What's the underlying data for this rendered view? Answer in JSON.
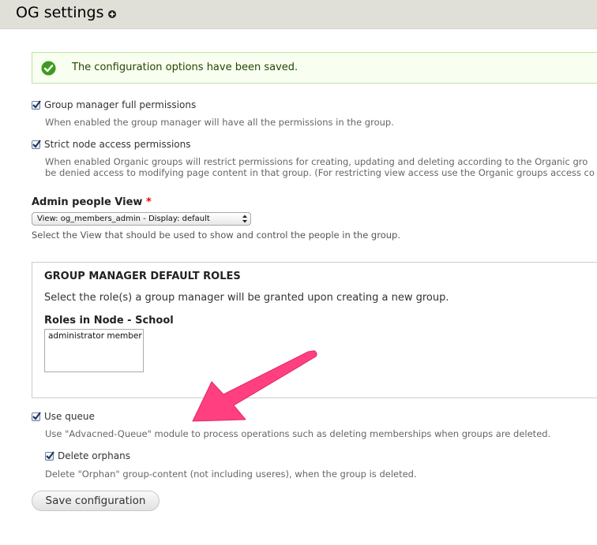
{
  "header": {
    "title": "OG settings",
    "shortcut_icon": "plus-circle-icon"
  },
  "message": {
    "icon": "check-circle-icon",
    "text": "The configuration options have been saved.",
    "color": "#234600"
  },
  "options": [
    {
      "label": "Group manager full permissions",
      "checked": true,
      "description": "When enabled the group manager will have all the permissions in the group."
    },
    {
      "label": "Strict node access permissions",
      "checked": true,
      "description_line1": "When enabled Organic groups will restrict permissions for creating, updating and deleting according to the Organic gro",
      "description_line2": "be denied access to modifying page content in that group. (For restricting view access use the Organic groups access co"
    }
  ],
  "admin_view": {
    "label": "Admin people View",
    "required_marker": "*",
    "selected": "View: og_members_admin - Display: default",
    "description": "Select the View that should be used to show and control the people in the group."
  },
  "roles_fieldset": {
    "legend": "GROUP MANAGER DEFAULT ROLES",
    "description": "Select the role(s) a group manager will be granted upon creating a new group.",
    "roles_label": "Roles in Node - School",
    "options": [
      "administrator member"
    ]
  },
  "queue": {
    "label": "Use queue",
    "checked": true,
    "description": "Use \"Advacned-Queue\" module to process operations such as deleting memberships when groups are deleted.",
    "orphans": {
      "label": "Delete orphans",
      "checked": true,
      "description": "Delete \"Orphan\" group-content (not including useres), when the group is deleted."
    }
  },
  "annotation": {
    "icon": "pink-arrow-icon",
    "color": "#ff3f7f"
  },
  "actions": {
    "save_label": "Save configuration"
  }
}
